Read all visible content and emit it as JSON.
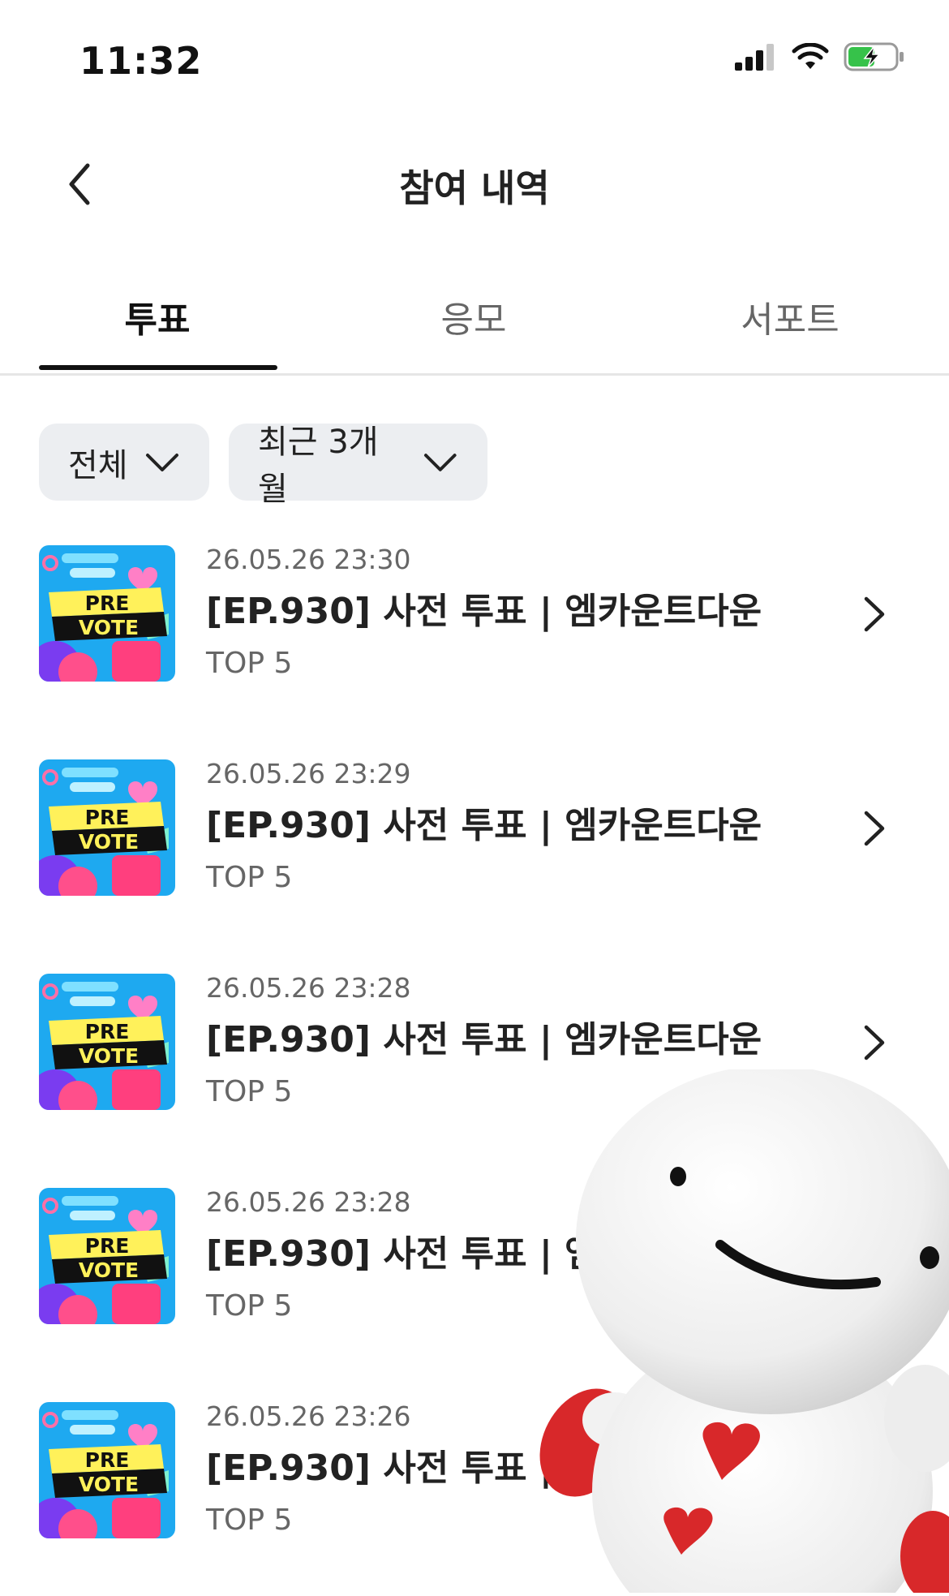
{
  "status_bar": {
    "time": "11:32"
  },
  "header": {
    "title": "참여 내역"
  },
  "tabs": [
    {
      "label": "투표",
      "active": true
    },
    {
      "label": "응모",
      "active": false
    },
    {
      "label": "서포트",
      "active": false
    }
  ],
  "filters": {
    "category": {
      "selected": "전체"
    },
    "period": {
      "selected": "최근 3개월"
    }
  },
  "thumbnail": {
    "line1": "PRE",
    "line2": "VOTE"
  },
  "items": [
    {
      "date": "26.05.26 23:30",
      "title": "[EP.930] 사전 투표 | 엠카운트다운",
      "sub": "TOP 5"
    },
    {
      "date": "26.05.26 23:29",
      "title": "[EP.930] 사전 투표 | 엠카운트다운",
      "sub": "TOP 5"
    },
    {
      "date": "26.05.26 23:28",
      "title": "[EP.930] 사전 투표 | 엠카운트다운",
      "sub": "TOP 5"
    },
    {
      "date": "26.05.26 23:28",
      "title": "[EP.930] 사전 투표 | 엠카운트다운",
      "sub": "TOP 5"
    },
    {
      "date": "26.05.26 23:26",
      "title": "[EP.930] 사전 투표 | 엠카운트다운",
      "sub": "TOP 5"
    }
  ],
  "colors": {
    "accent": "#111111",
    "chip_bg": "#eceef1",
    "thumb_bg": "#1ea9f0",
    "thumb_yellow": "#fff15a",
    "mascot_heart": "#d8282a"
  },
  "icons": {
    "back": "chevron-left-icon",
    "row": "chevron-right-icon",
    "dropdown": "chevron-down-icon"
  }
}
